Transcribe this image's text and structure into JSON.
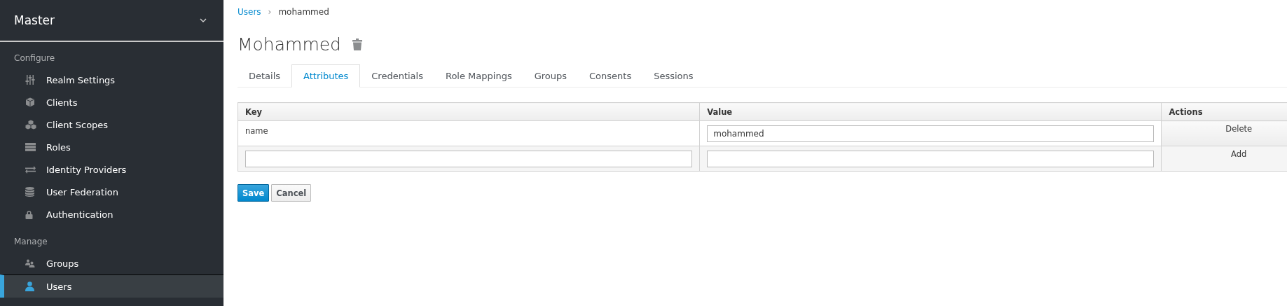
{
  "sidebar": {
    "realm": "Master",
    "sections": [
      {
        "heading": "Configure",
        "items": [
          {
            "label": "Realm Settings",
            "selected": false
          },
          {
            "label": "Clients",
            "selected": false
          },
          {
            "label": "Client Scopes",
            "selected": false
          },
          {
            "label": "Roles",
            "selected": false
          },
          {
            "label": "Identity Providers",
            "selected": false
          },
          {
            "label": "User Federation",
            "selected": false
          },
          {
            "label": "Authentication",
            "selected": false
          }
        ]
      },
      {
        "heading": "Manage",
        "items": [
          {
            "label": "Groups",
            "selected": false
          },
          {
            "label": "Users",
            "selected": true
          }
        ]
      }
    ]
  },
  "breadcrumb": {
    "link": "Users",
    "separator": "›",
    "current": "mohammed"
  },
  "title": "Mohammed",
  "tabs": [
    {
      "label": "Details",
      "selected": false
    },
    {
      "label": "Attributes",
      "selected": true
    },
    {
      "label": "Credentials",
      "selected": false
    },
    {
      "label": "Role Mappings",
      "selected": false
    },
    {
      "label": "Groups",
      "selected": false
    },
    {
      "label": "Consents",
      "selected": false
    },
    {
      "label": "Sessions",
      "selected": false
    }
  ],
  "table": {
    "columns": [
      "Key",
      "Value",
      "Actions"
    ],
    "rows": [
      {
        "key": {
          "kind": "text",
          "text": "name"
        },
        "value": {
          "kind": "input",
          "value": "mohammed"
        },
        "action": "Delete"
      },
      {
        "key": {
          "kind": "input"
        },
        "value": {
          "kind": "input"
        },
        "action": "Add"
      }
    ]
  },
  "buttons": [
    {
      "label": "Save",
      "kind": "primary"
    },
    {
      "label": "Cancel",
      "kind": "default"
    }
  ]
}
